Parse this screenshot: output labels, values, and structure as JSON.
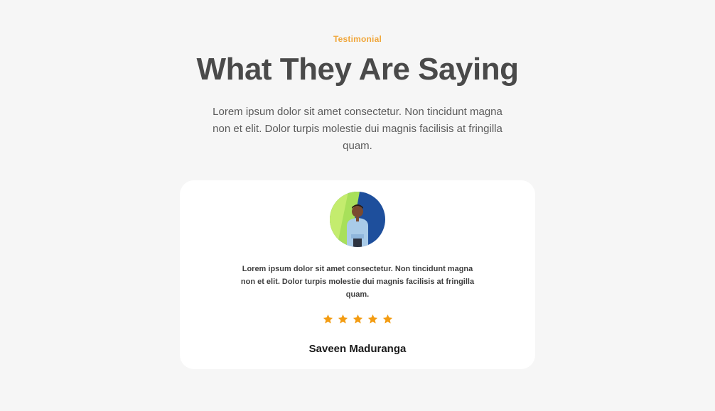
{
  "section": {
    "eyebrow": "Testimonial",
    "title": "What They Are Saying",
    "subtitle": "Lorem ipsum dolor sit amet consectetur. Non tincidunt magna non et elit. Dolor turpis molestie dui magnis facilisis at fringilla quam."
  },
  "testimonial": {
    "quote": "Lorem ipsum dolor sit amet consectetur. Non tincidunt magna non et elit. Dolor turpis molestie dui magnis facilisis at fringilla quam.",
    "rating": 5,
    "rating_max": 5,
    "author": "Saveen Maduranga",
    "avatar_icon": "person-photo"
  },
  "colors": {
    "accent": "#f0a63a",
    "star": "#f39c12",
    "background": "#f6f6f6",
    "card": "#ffffff",
    "heading": "#4a4a4a"
  }
}
